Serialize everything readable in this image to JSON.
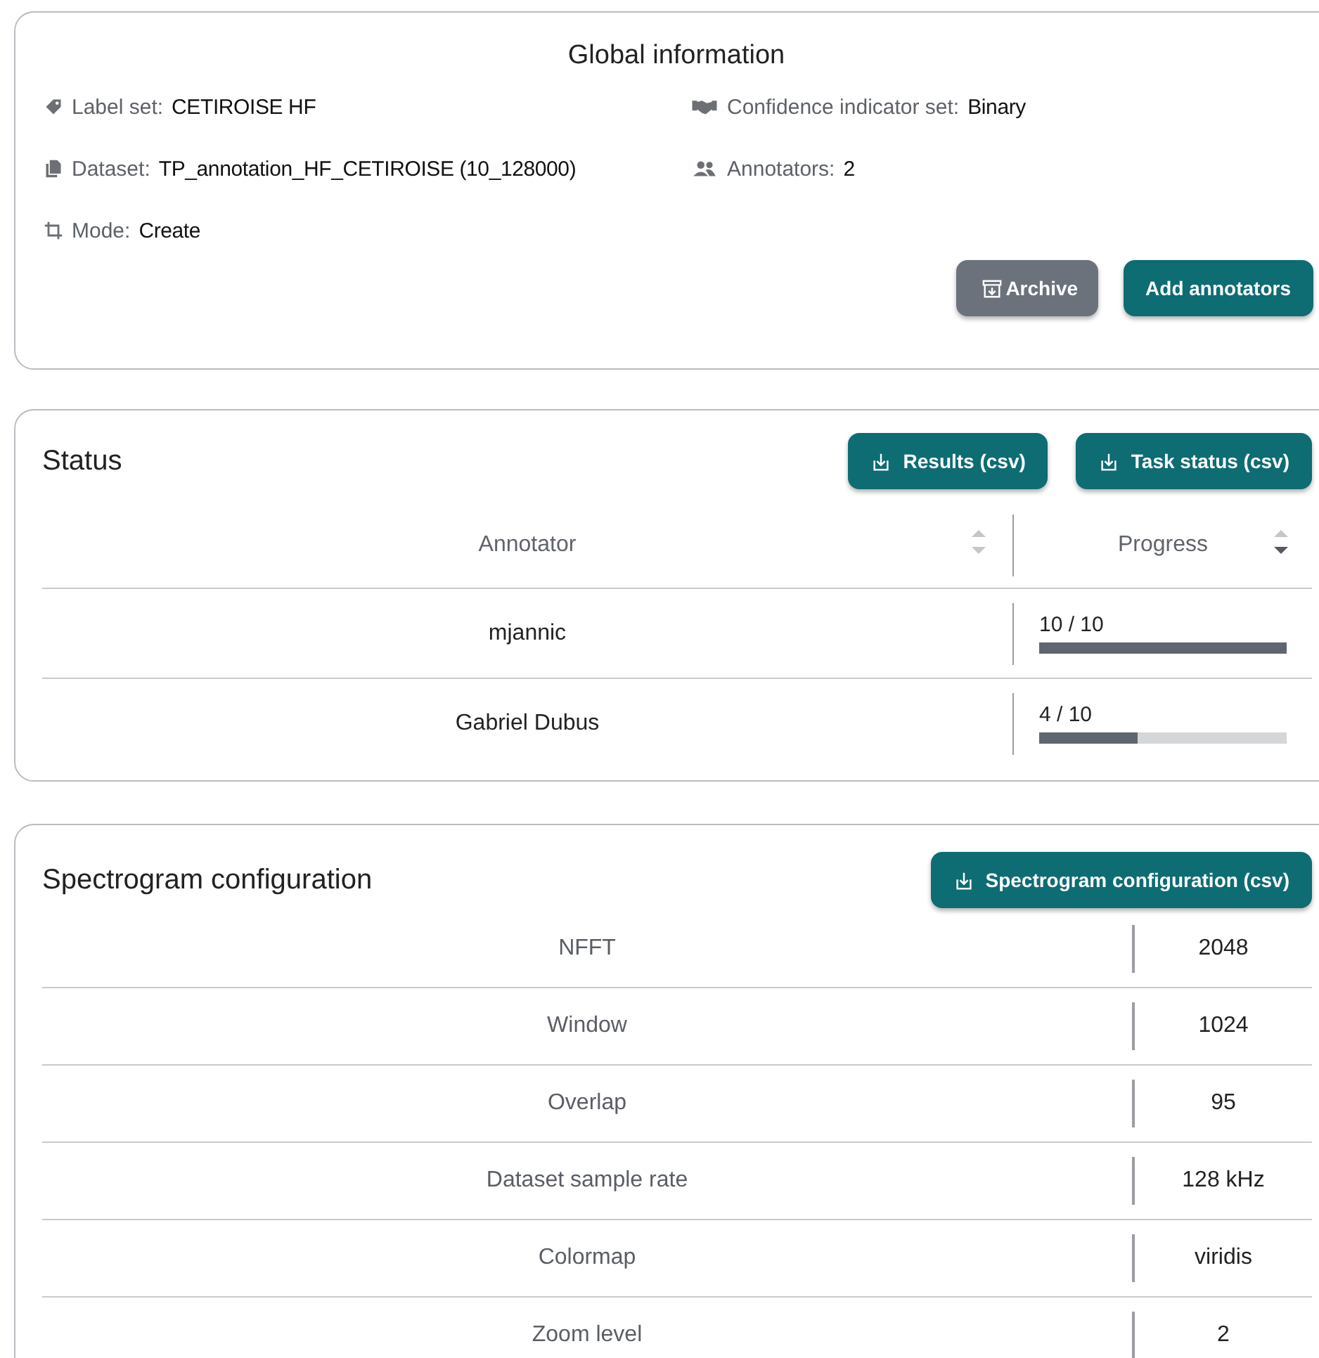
{
  "global_information": {
    "title": "Global information",
    "items": [
      {
        "kind": "tag",
        "label": "Label set:",
        "value": "CETIROISE HF"
      },
      {
        "kind": "handshake",
        "label": "Confidence indicator set:",
        "value": "Binary"
      },
      {
        "kind": "copy",
        "label": "Dataset:",
        "value": "TP_annotation_HF_CETIROISE (10_128000)"
      },
      {
        "kind": "people",
        "label": "Annotators:",
        "value": "2"
      },
      {
        "kind": "crop",
        "label": "Mode:",
        "value": "Create"
      }
    ],
    "buttons": [
      {
        "kind": "secondary",
        "label": "Archive"
      },
      {
        "kind": "primary",
        "label": "Add annotators"
      }
    ]
  },
  "status": {
    "title": "Status",
    "buttons": [
      {
        "label": "Results (csv)"
      },
      {
        "label": "Task status (csv)"
      }
    ],
    "columns": [
      {
        "label": "Annotator",
        "kind": "unsorted"
      },
      {
        "label": "Progress",
        "kind": "descending"
      }
    ],
    "rows": [
      {
        "annotator": "mjannic",
        "progress": "10 / 10",
        "level": 1
      },
      {
        "annotator": "Gabriel Dubus",
        "progress": "4 / 10",
        "level": 0.4
      }
    ]
  },
  "spectrogram_configuration": {
    "title": "Spectrogram configuration",
    "button": "Spectrogram configuration (csv)",
    "rows": [
      {
        "label": "NFFT",
        "value": "2048"
      },
      {
        "label": "Window",
        "value": "1024"
      },
      {
        "label": "Overlap",
        "value": "95"
      },
      {
        "label": "Dataset sample rate",
        "value": "128 kHz"
      },
      {
        "label": "Colormap",
        "value": "viridis"
      },
      {
        "label": "Zoom level",
        "value": "2"
      }
    ]
  }
}
